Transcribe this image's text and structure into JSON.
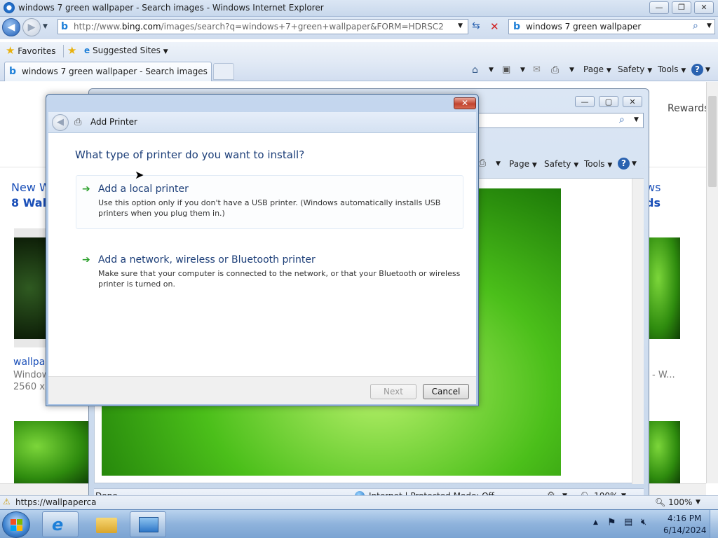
{
  "ie": {
    "window_title": "windows 7 green wallpaper - Search images - Windows Internet Explorer",
    "address_prefix": "http://www.",
    "address_domain": "bing.com",
    "address_rest": "/images/search?q=windows+7+green+wallpaper&FORM=HDRSC2",
    "search_value": "windows 7 green wallpaper",
    "favorites_label": "Favorites",
    "suggested_sites_label": "Suggested Sites",
    "tab_label": "windows 7 green wallpaper - Search images",
    "cmd_page": "Page",
    "cmd_safety": "Safety",
    "cmd_tools": "Tools",
    "status_url": "https://wallpaperca",
    "zoom": "100%"
  },
  "page": {
    "rewards": "Rewards",
    "new_w": "New W",
    "eight_wall": "8 Wall",
    "wallpa": "wallpa",
    "window": "Window",
    "res": "2560 x",
    "ws": "ws",
    "ds": "ds",
    "w_trail": "- W..."
  },
  "inner": {
    "cmd_page": "Page",
    "cmd_safety": "Safety",
    "cmd_tools": "Tools",
    "status_done": "Done",
    "status_zone": "Internet | Protected Mode: Off",
    "zoom": "100%"
  },
  "dialog": {
    "title": "Add Printer",
    "question": "What type of printer do you want to install?",
    "options": [
      {
        "title": "Add a local printer",
        "desc": "Use this option only if you don't have a USB printer. (Windows automatically installs USB printers when you plug them in.)"
      },
      {
        "title": "Add a network, wireless or Bluetooth printer",
        "desc": "Make sure that your computer is connected to the network, or that your Bluetooth or wireless printer is turned on."
      }
    ],
    "next_label": "Next",
    "cancel_label": "Cancel"
  },
  "taskbar": {
    "time": "4:16 PM",
    "date": "6/14/2024"
  },
  "colors": {
    "dialog_heading": "#1c3e78",
    "option_arrow": "#2ba02b",
    "close_red": "#c1432f"
  }
}
